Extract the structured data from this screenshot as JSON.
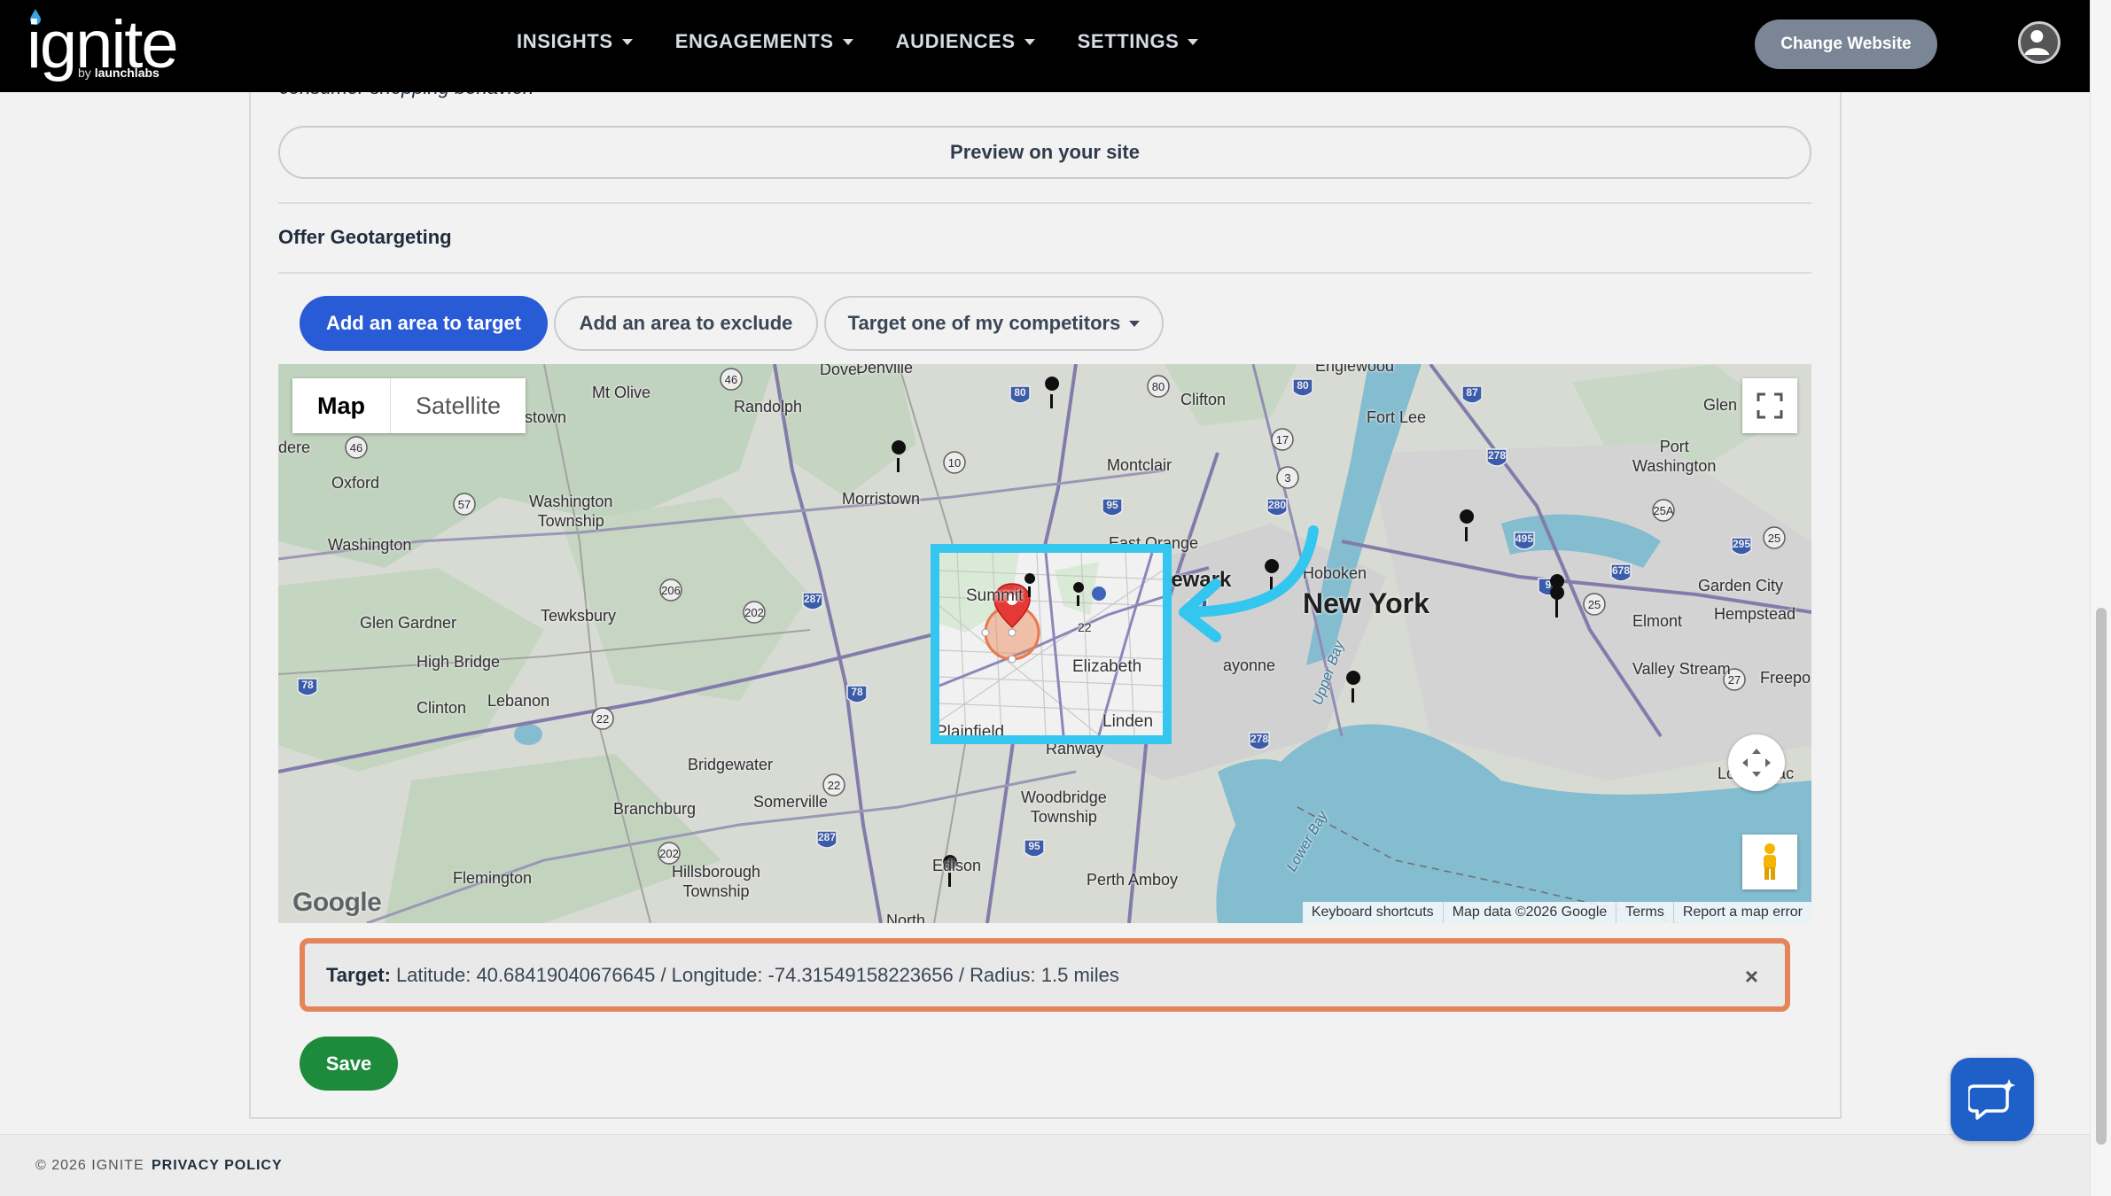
{
  "brand": {
    "name": "ignite",
    "by_prefix": "by ",
    "by_name": "launchlabs"
  },
  "nav": {
    "items": [
      {
        "label": "INSIGHTS"
      },
      {
        "label": "ENGAGEMENTS"
      },
      {
        "label": "AUDIENCES"
      },
      {
        "label": "SETTINGS"
      }
    ],
    "change_website": "Change Website"
  },
  "content": {
    "truncated_text": "consumer shopping behavior.",
    "preview_button": "Preview on your site",
    "section_title": "Offer Geotargeting",
    "buttons": {
      "target": "Add an area to target",
      "exclude": "Add an area to exclude",
      "competitor": "Target one of my competitors"
    }
  },
  "map": {
    "type_controls": {
      "map": "Map",
      "satellite": "Satellite",
      "selected": "Map"
    },
    "google": "Google",
    "attribution": [
      "Keyboard shortcuts",
      "Map data ©2026 Google",
      "Terms",
      "Report a map error"
    ],
    "labels": {
      "dover": "Dover",
      "denville": "Denville",
      "mt_olive": "Mt Olive",
      "randolph": "Randolph",
      "stown": "stown",
      "clifton": "Clifton",
      "englewood": "Englewood",
      "fort_lee": "Fort Lee",
      "glen": "Glen",
      "port_washington": "Port Washington",
      "oxford": "Oxford",
      "dere": "dere",
      "montclair": "Montclair",
      "morristown": "Morristown",
      "washington_township": "Washington\nTownship",
      "washington": "Washington",
      "east_orange": "East Orange",
      "newark": "Newark",
      "hoboken": "Hoboken",
      "new_york": "New York",
      "garden_city": "Garden City",
      "elmont": "Elmont",
      "hempstead": "Hempstead",
      "valley_stream": "Valley Stream",
      "freepo": "Freepo",
      "glen_gardner": "Glen Gardner",
      "tewksbury": "Tewksbury",
      "high_bridge": "High Bridge",
      "clinton": "Clinton",
      "lebanon": "Lebanon",
      "bayonne": "ayonne",
      "upper_bay": "Upper Bay",
      "bridgewater": "Bridgewater",
      "somerville": "Somerville",
      "branchburg": "Branchburg",
      "rahway": "Rahway",
      "woodbridge_township": "Woodbridge\nTownship",
      "long_beach": "Long Beac",
      "flemington": "Flemington",
      "hillsborough_township": "Hillsborough\nTownship",
      "edison": "Edison",
      "perth_amboy": "Perth Amboy",
      "lower_bay": "Lower Bay",
      "north": "North"
    },
    "inset_labels": {
      "summit": "Summit",
      "elizabeth": "Elizabeth",
      "linden": "Linden",
      "plainfield": "Plainfield",
      "route_22": "22"
    }
  },
  "target": {
    "label": "Target:",
    "value": "Latitude: 40.68419040676645 / Longitude: -74.31549158223656 / Radius: 1.5 miles",
    "close": "×"
  },
  "save": "Save",
  "footer": {
    "copyright": "© 2026 IGNITE",
    "privacy": "PRIVACY POLICY"
  },
  "colors": {
    "primary": "#2a5bd7",
    "save": "#1e8a3c",
    "highlight_border": "#e4845b",
    "inset_border": "#33c6ee",
    "water": "#7ec8e0",
    "arrow": "#33c6ee"
  },
  "icons": {
    "fullscreen": "fullscreen-icon",
    "camera_control": "camera-control-icon",
    "pegman": "pegman-icon",
    "chat": "chat-icon",
    "user": "user-icon",
    "close": "close-icon",
    "pin": "map-pin-icon"
  }
}
